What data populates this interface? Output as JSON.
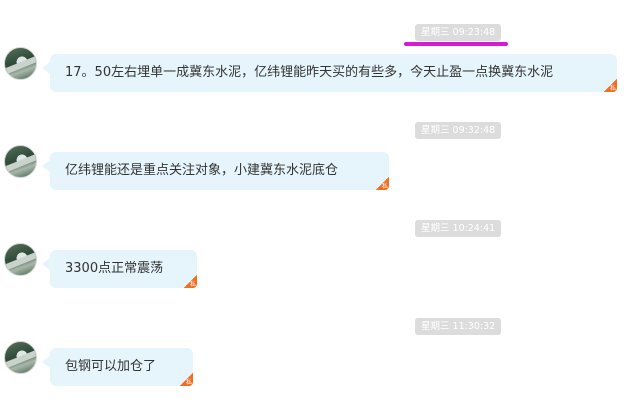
{
  "messages": [
    {
      "timestamp": "星期三 09:23:48",
      "text": "17。50左右埋单一成冀东水泥，亿纬锂能昨天买的有些多，今天止盈一点换冀东水泥",
      "badge": "私"
    },
    {
      "timestamp": "星期三 09:32:48",
      "text": "亿纬锂能还是重点关注对象，小建冀东水泥底仓",
      "badge": "私"
    },
    {
      "timestamp": "星期三 10:24:41",
      "text": "3300点正常震荡",
      "badge": "私"
    },
    {
      "timestamp": "星期三 11:30:32",
      "text": "包钢可以加仓了",
      "badge": "私"
    }
  ],
  "colors": {
    "bubble": "#e6f4fc",
    "timestamp_bg": "#dcdcdc",
    "highlight_underline": "#d51bd5",
    "badge": "#ef6e22"
  }
}
